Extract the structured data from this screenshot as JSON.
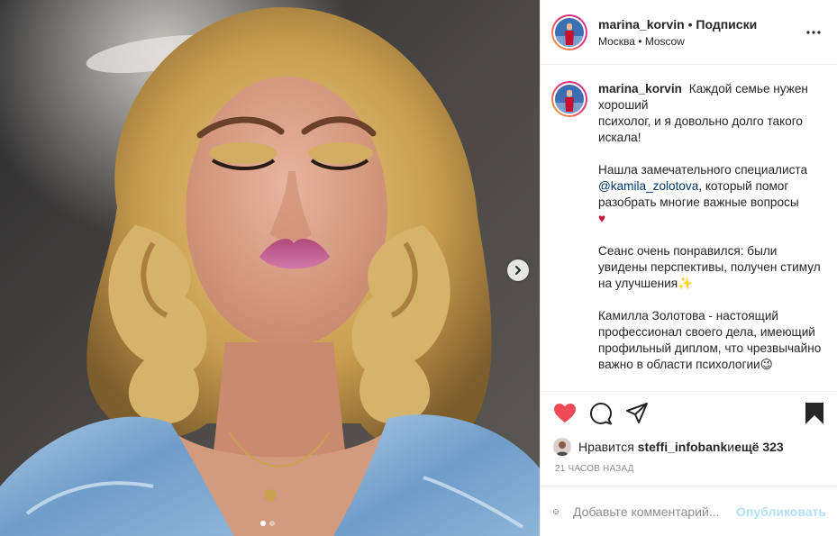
{
  "post": {
    "author": "marina_korvin",
    "separator": " • ",
    "follow_label": "Подписки",
    "location": "Москва • Moscow",
    "more_icon": "more-horizontal-icon",
    "caption": {
      "author": "marina_korvin",
      "p1_line1": "Каждой семье нужен хороший",
      "p1_line2": "психолог, и я довольно долго такого искала!",
      "p2_before": "Нашла замечательного специалиста",
      "p2_mention": "@kamila_zolotova",
      "p2_after": ", который помог разобрать многие важные вопросы",
      "p2_emoji": "♥",
      "p3": "Сеанс очень понравился: были увидены перспективы, получен стимул на улучшения",
      "p3_emoji": "✨",
      "p4": "Камилла Золотова - настоящий профессионал своего дела, имеющий профильный диплом, что чрезвычайно важно в области психологии",
      "p4_emoji": "😉"
    },
    "likes": {
      "prefix": "Нравится",
      "user": "steffi_infobank",
      "joiner": " и ",
      "others": "ещё 323"
    },
    "time": "21 часов назад",
    "comment": {
      "placeholder": "Добавьте комментарий...",
      "publish_label": "Опубликовать"
    }
  },
  "colors": {
    "like": "#ed4956",
    "publish_disabled": "#b2dffc",
    "mention": "#00376b",
    "avatar_ring_start": "#f9b233",
    "avatar_ring_end": "#c1359b"
  },
  "carousel": {
    "slide_count": 2,
    "active_slide": 1
  }
}
